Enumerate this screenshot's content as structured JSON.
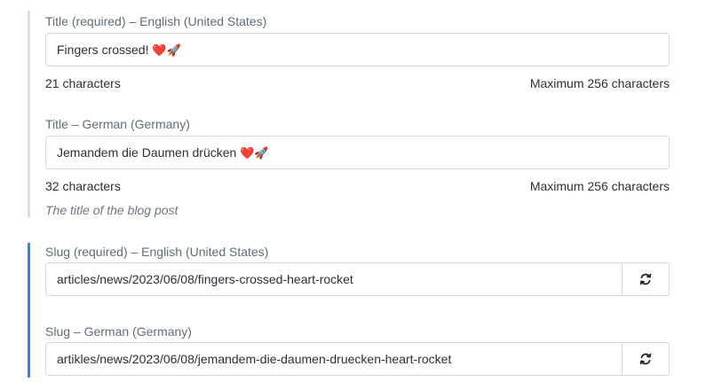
{
  "title_section": {
    "en": {
      "label": "Title (required) – English (United States)",
      "value": "Fingers crossed! ",
      "count": "21 characters",
      "max": "Maximum 256 characters"
    },
    "de": {
      "label": "Title – German (Germany)",
      "value": "Jemandem die Daumen drücken ",
      "count": "32 characters",
      "max": "Maximum 256 characters"
    },
    "help": "The title of the blog post"
  },
  "slug_section": {
    "en": {
      "label": "Slug (required) – English (United States)",
      "value": "articles/news/2023/06/08/fingers-crossed-heart-rocket"
    },
    "de": {
      "label": "Slug – German (Germany)",
      "value": "artikles/news/2023/06/08/jemandem-die-daumen-druecken-heart-rocket"
    }
  },
  "emoji": {
    "heart": "❤️",
    "rocket": "🚀"
  },
  "icons": {
    "refresh": "refresh-icon"
  },
  "colors": {
    "active_border": "#2f80ed",
    "inactive_border": "#d6dde6"
  }
}
